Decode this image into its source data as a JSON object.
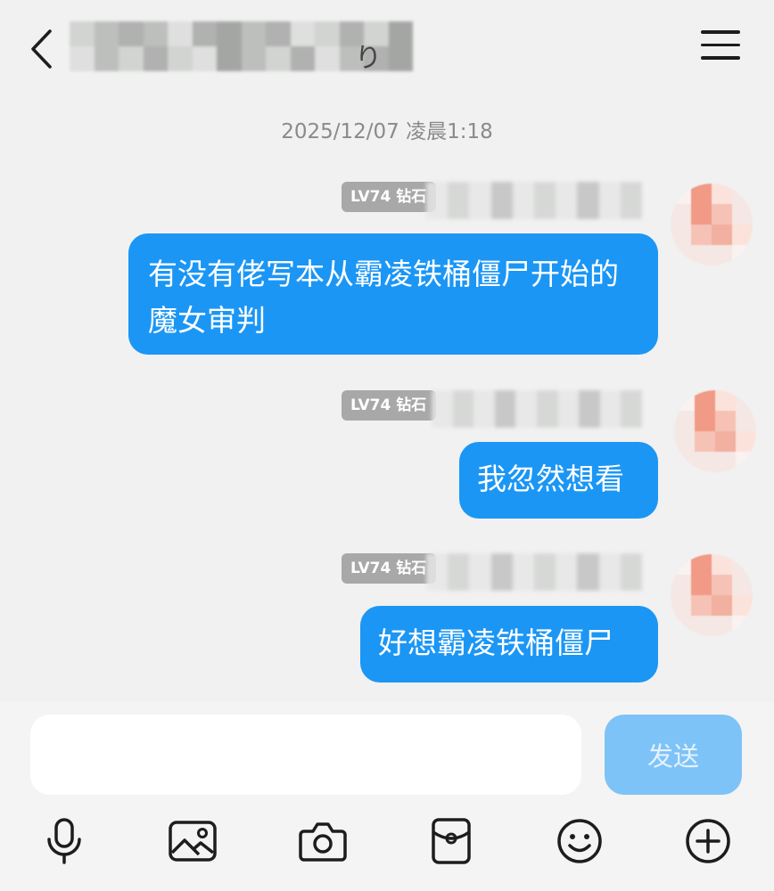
{
  "header": {
    "title_suffix": "り",
    "back_icon": "chevron-left-icon",
    "menu_icon": "hamburger-menu-icon"
  },
  "timestamp": "2025/12/07 凌晨1:18",
  "messages": [
    {
      "badge": "LV74 钻石",
      "text": "有没有佬写本从霸凌铁桶僵尸开始的魔女审判"
    },
    {
      "badge": "LV74 钻石",
      "text": "我忽然想看"
    },
    {
      "badge": "LV74 钻石",
      "text": "好想霸凌铁桶僵尸"
    }
  ],
  "composer": {
    "placeholder": "",
    "value": "",
    "send_label": "发送"
  },
  "toolbar": [
    {
      "icon": "microphone-icon"
    },
    {
      "icon": "image-icon"
    },
    {
      "icon": "camera-icon"
    },
    {
      "icon": "red-packet-icon"
    },
    {
      "icon": "emoji-icon"
    },
    {
      "icon": "plus-icon"
    }
  ],
  "colors": {
    "bubble": "#1b96f5",
    "background": "#f1f1f1",
    "send_disabled": "#7ec3f7",
    "badge": "#a8a8a8"
  }
}
